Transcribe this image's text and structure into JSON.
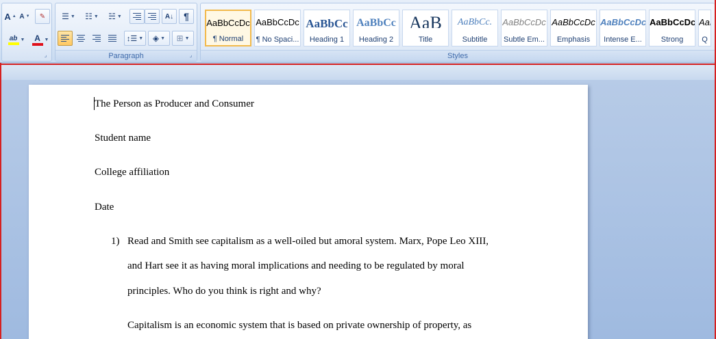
{
  "ribbon": {
    "font_group": {
      "grow_font": "A",
      "shrink_font": "A",
      "highlight_label": "ab",
      "font_color_label": "A",
      "highlight_color": "#ffff00",
      "font_color": "#e0101a"
    },
    "paragraph": {
      "label": "Paragraph",
      "pilcrow": "¶"
    },
    "styles": {
      "label": "Styles",
      "items": [
        {
          "sample": "AaBbCcDc",
          "name": "¶ Normal",
          "selected": true
        },
        {
          "sample": "AaBbCcDc",
          "name": "¶ No Spaci..."
        },
        {
          "sample": "AaBbCc",
          "name": "Heading 1"
        },
        {
          "sample": "AaBbCc",
          "name": "Heading 2"
        },
        {
          "sample": "AaB",
          "name": "Title"
        },
        {
          "sample": "AaBbCc.",
          "name": "Subtitle"
        },
        {
          "sample": "AaBbCcDc",
          "name": "Subtle Em..."
        },
        {
          "sample": "AaBbCcDc",
          "name": "Emphasis"
        },
        {
          "sample": "AaBbCcDc",
          "name": "Intense E..."
        },
        {
          "sample": "AaBbCcDc",
          "name": "Strong"
        },
        {
          "sample": "AaBbCcDc",
          "name": "Q"
        }
      ]
    }
  },
  "document": {
    "title": "The Person as Producer and Consumer",
    "student": "Student name",
    "college": "College affiliation",
    "date": "Date",
    "list_number": "1)",
    "question_lines": [
      "Read and Smith see capitalism as a well-oiled but amoral system. Marx, Pope Leo XIII,",
      "and Hart see it as having moral implications and needing to be regulated by moral",
      "principles. Who do you think is right and why?"
    ],
    "answer_line": "Capitalism is an economic system that is based on private ownership of property, as"
  },
  "colors": {
    "ribbon_text": "#1e3f73",
    "selection_red": "#d62020",
    "workspace": "#a9c1e3"
  }
}
